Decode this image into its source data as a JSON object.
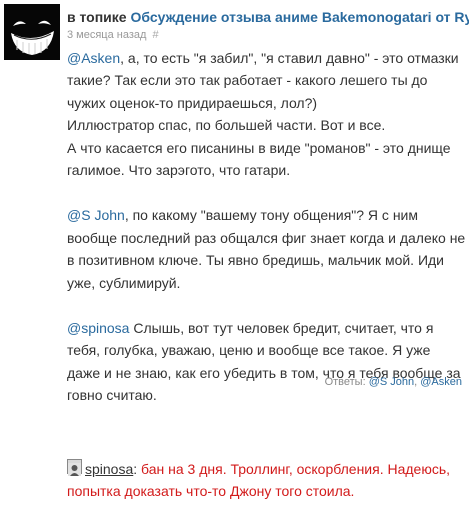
{
  "header": {
    "in_topic": "в топике",
    "topic_title": "Обсуждение отзыва аниме Bakemonogatari от Ryo...",
    "time_ago": "3 месяца назад",
    "hash": "#"
  },
  "comment": {
    "p1_mention": "@Asken",
    "p1_text": ", а, то есть \"я забил\", \"я ставил давно\" - это отмазки такие? Так если это так работает - какого лешего ты до чужих оценок-то придираешься, лол?)",
    "p2": "Иллюстратор спас, по большей части. Вот и все.",
    "p3": "А что касается его писанины в виде \"романов\" - это днище галимое. Что зарэгото, что гатари.",
    "p4_mention": "@S John",
    "p4_text": ", по какому \"вашему тону общения\"? Я с ним вообще последний раз общался фиг знает когда и далеко не в позитивном ключе. Ты явно бредишь, мальчик мой. Иди уже, сублимируй.",
    "p5_mention": "@spinosa",
    "p5_text": " Слышь, вот тут человек бредит, считает, что я тебя, голубка, уважаю, ценю и вообще все такое. Я уже даже и не знаю, как его убедить в том, что я тебя вообще за говно считаю."
  },
  "replies": {
    "label": "Ответы: ",
    "items": [
      "@S John",
      "@Asken"
    ],
    "separator": ", "
  },
  "moderation": {
    "moderator": "spinosa",
    "colon": ": ",
    "text": "бан на 3 дня. Троллинг, оскорбления. Надеюсь, попытка доказать что-то Джону того стоила."
  },
  "colors": {
    "link": "#2a6a9e",
    "ban_text": "#d21a1a",
    "meta": "#999999"
  }
}
